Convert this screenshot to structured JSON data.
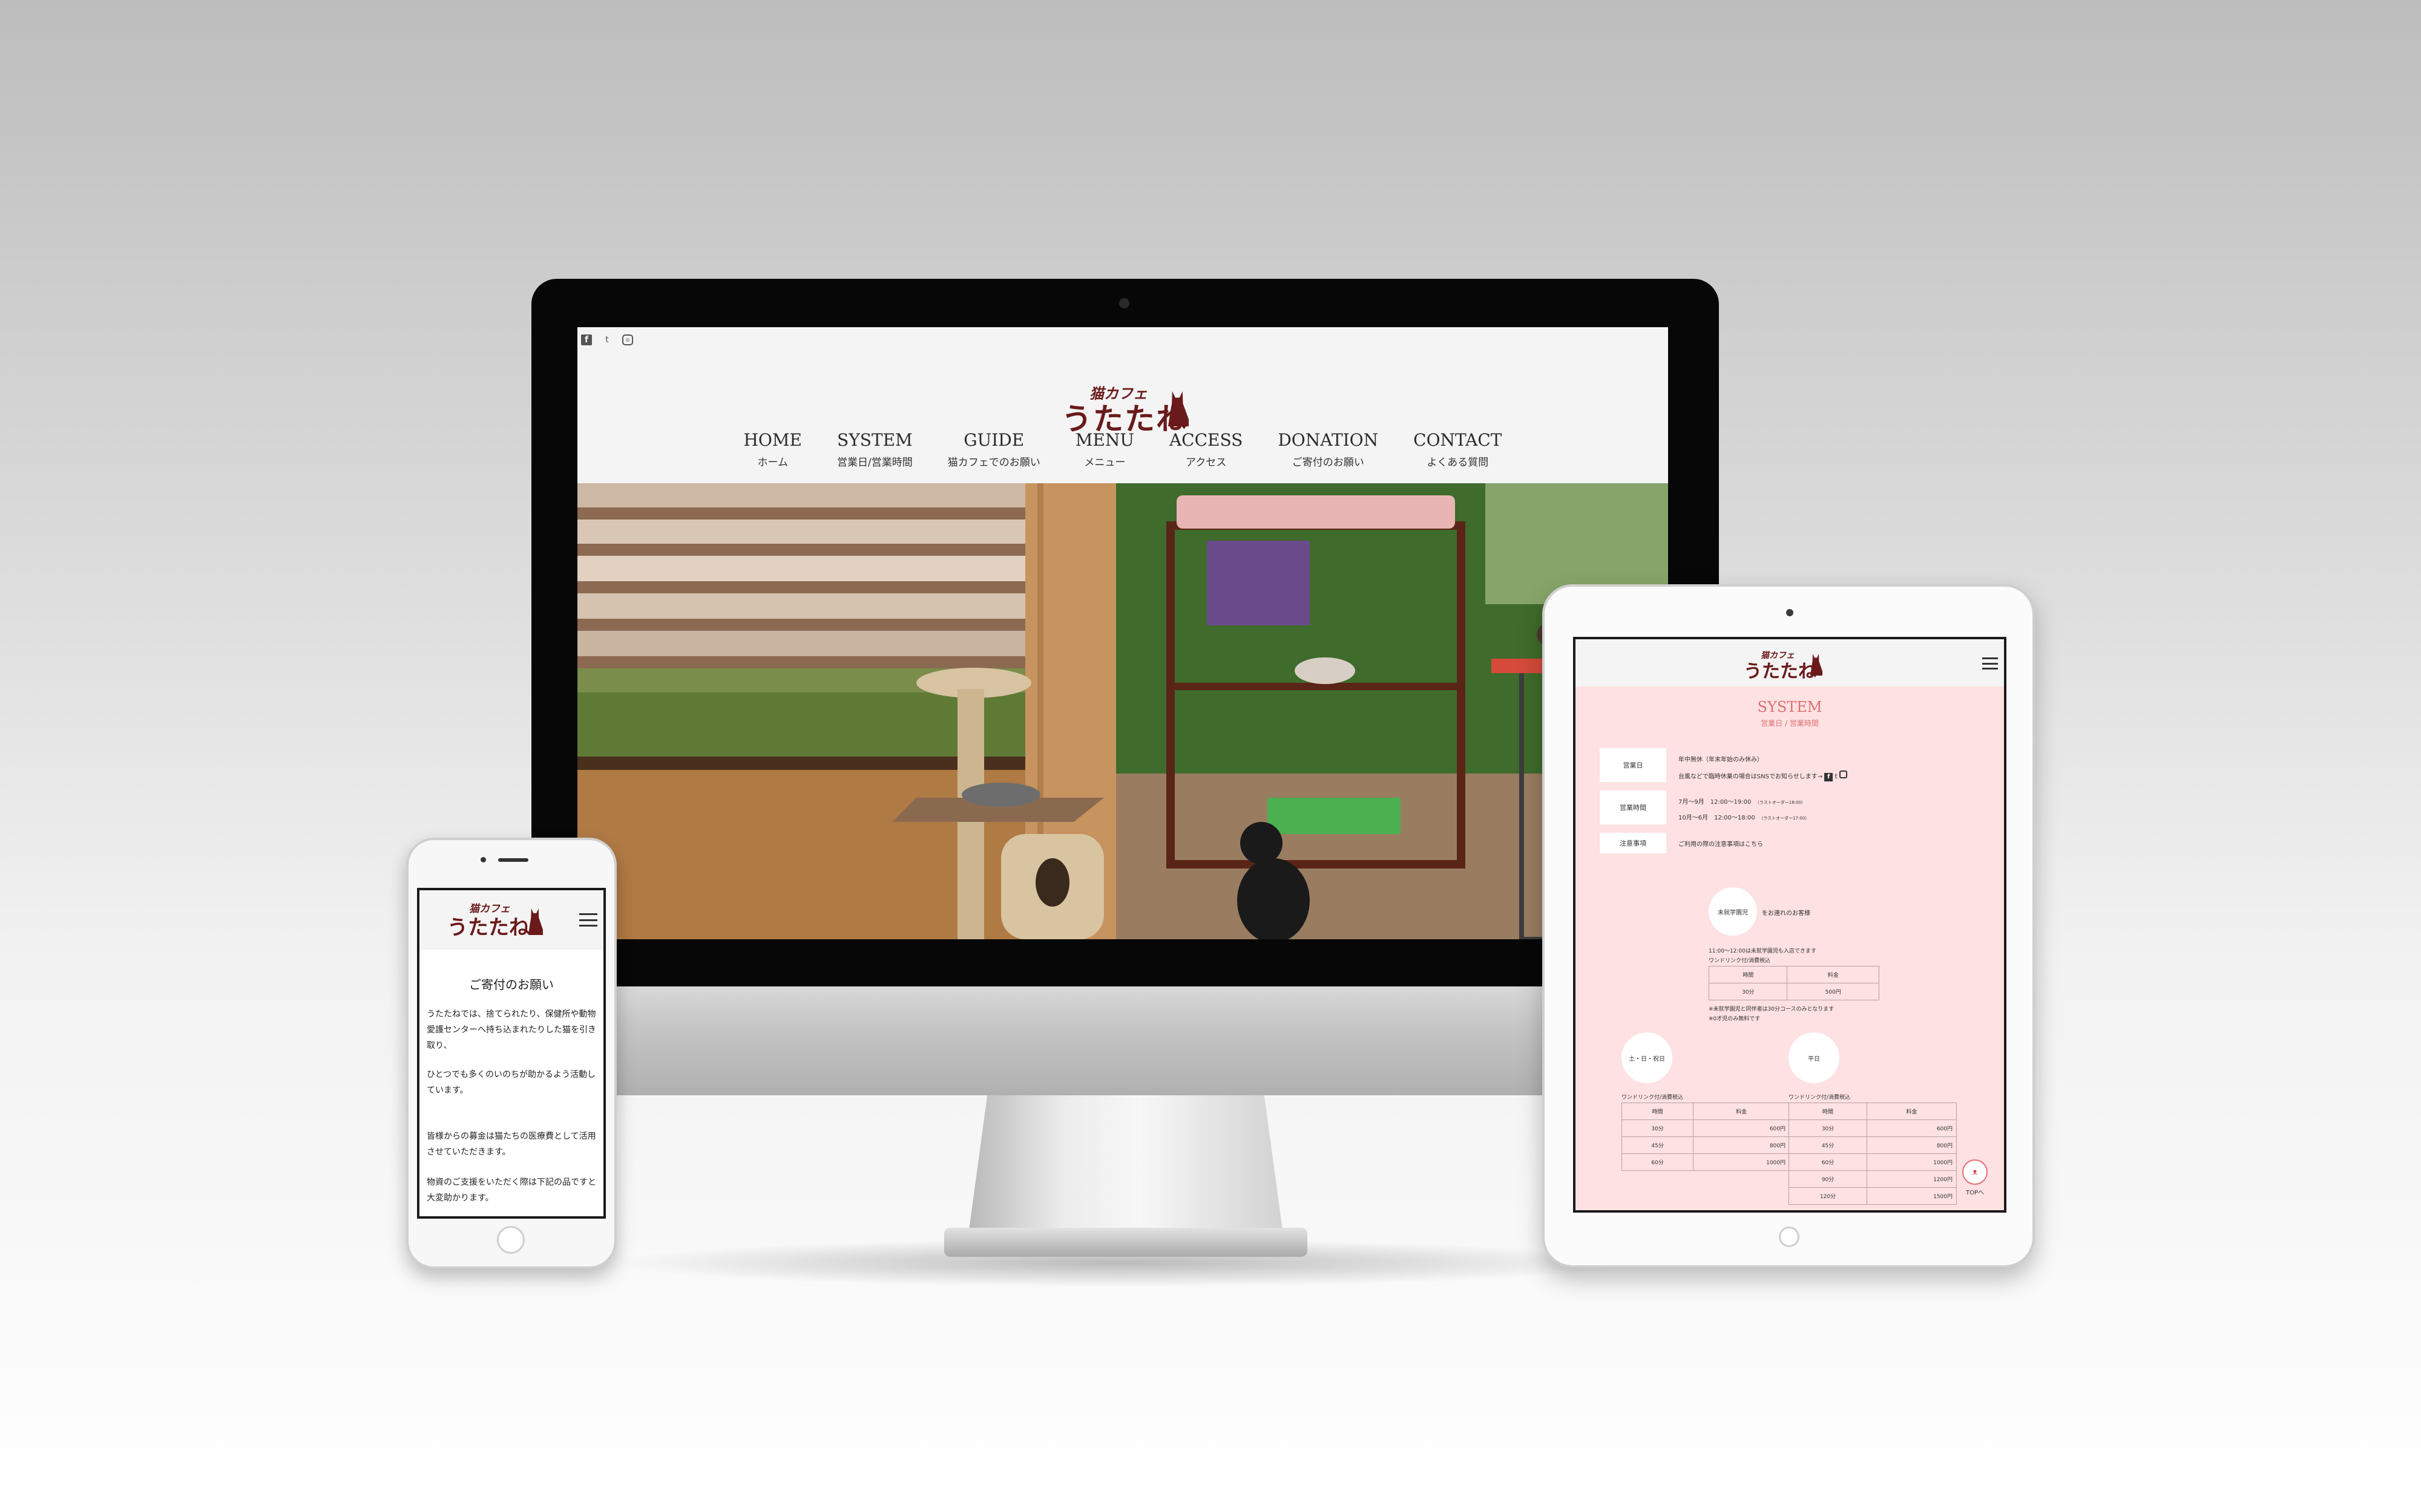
{
  "desktop": {
    "social": [
      "f",
      "t",
      "◎"
    ],
    "logo": {
      "small": "猫カフェ",
      "big": "うたたね"
    },
    "nav": [
      {
        "en": "HOME",
        "jp": "ホーム"
      },
      {
        "en": "SYSTEM",
        "jp": "営業日/営業時間"
      },
      {
        "en": "GUIDE",
        "jp": "猫カフェでのお願い"
      },
      {
        "en": "MENU",
        "jp": "メニュー"
      },
      {
        "en": "ACCESS",
        "jp": "アクセス"
      },
      {
        "en": "DONATION",
        "jp": "ご寄付のお願い"
      },
      {
        "en": "CONTACT",
        "jp": "よくある質問"
      }
    ]
  },
  "tablet": {
    "logo": {
      "small": "猫カフェ",
      "big": "うたたね"
    },
    "section_title": "SYSTEM",
    "section_sub": "営業日 / 営業時間",
    "rows": [
      {
        "label": "営業日",
        "lines": [
          "年中無休（年末年始のみ休み）",
          "台風などで臨時休業の場合はSNSでお知らせします→"
        ]
      },
      {
        "label": "営業時間",
        "lines": [
          "7月〜9月　12:00〜19:00",
          "10月〜6月　12:00〜18:00"
        ],
        "notes": [
          "（ラストオーダー18:00）",
          "（ラストオーダー17:00）"
        ]
      },
      {
        "label": "注意事項",
        "lines": [
          "ご利用の際の注意事項はこちら"
        ]
      }
    ],
    "kids": {
      "circle": "未就学園児",
      "title": "をお連れのお客様",
      "note1": "11:00〜12:00は未就学園児も入店できます",
      "note2": "ワンドリンク付/消費税込",
      "headers": [
        "時間",
        "料金"
      ],
      "rows": [
        [
          "30分",
          "500円"
        ]
      ],
      "note3": "※未就学園児と同伴者は30分コースのみとなります",
      "note4": "※0才児のみ無料です"
    },
    "weekend": {
      "circle": "土・日・祝日",
      "note": "ワンドリンク付/消費税込",
      "headers": [
        "時間",
        "料金"
      ],
      "rows": [
        [
          "30分",
          "600円"
        ],
        [
          "45分",
          "800円"
        ],
        [
          "60分",
          "1000円"
        ]
      ]
    },
    "weekday": {
      "circle": "平日",
      "note": "ワンドリンク付/消費税込",
      "headers": [
        "時間",
        "料金"
      ],
      "rows": [
        [
          "30分",
          "600円"
        ],
        [
          "45分",
          "800円"
        ],
        [
          "60分",
          "1000円"
        ],
        [
          "90分",
          "1200円"
        ],
        [
          "120分",
          "1500円"
        ]
      ]
    },
    "top_button": "TOPへ"
  },
  "phone": {
    "logo": {
      "small": "猫カフェ",
      "big": "うたたね"
    },
    "title": "ご寄付のお願い",
    "paragraphs": [
      "うたたねでは、捨てられたり、保健所や動物愛護センターへ持ち込まれたりした猫を引き取り、",
      "ひとつでも多くのいのちが助かるよう活動しています。",
      "皆様からの募金は猫たちの医療費として活用させていただきます。",
      "物資のご支援をいただく際は下記の品ですと大変助かります。"
    ]
  }
}
